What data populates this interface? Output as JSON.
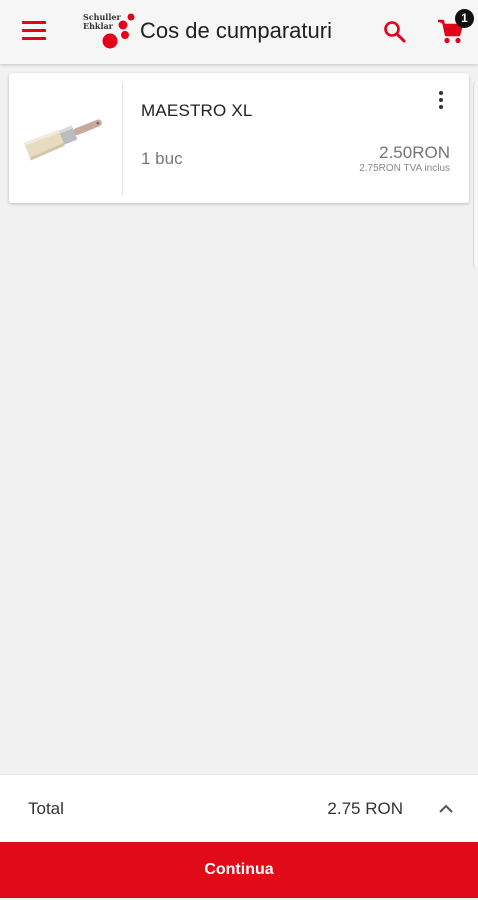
{
  "header": {
    "title": "Cos de cumparaturi",
    "logo_text": "Schuller\nEhklar",
    "cart_count": "1",
    "icons": [
      "menu-icon",
      "search-icon",
      "cart-icon"
    ],
    "accent_color": "#e2001a"
  },
  "cart": {
    "items": [
      {
        "name": "MAESTRO XL",
        "quantity": "1 buc",
        "price": "2.50RON",
        "price_with_vat": "2.75RON TVA inclus",
        "image": "paint-brush"
      }
    ]
  },
  "summary": {
    "total_label": "Total",
    "total_value": "2.75 RON"
  },
  "actions": {
    "continue_label": "Continua",
    "button_color": "#e10a17"
  }
}
